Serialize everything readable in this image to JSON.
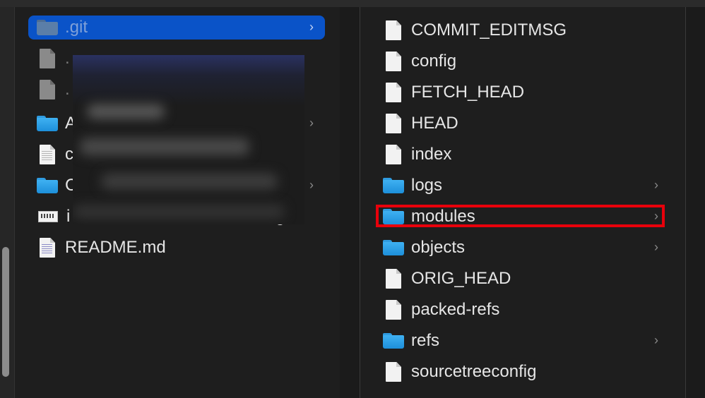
{
  "left_column": {
    "items": [
      {
        "label": ".git",
        "icon": "folder-icon",
        "has_children": true,
        "selected": true
      },
      {
        "label": ".",
        "icon": "file-icon",
        "has_children": false
      },
      {
        "label": ".",
        "icon": "file-icon",
        "has_children": false
      },
      {
        "label": "A",
        "icon": "folder-icon",
        "has_children": true
      },
      {
        "label": "c",
        "icon": "text-file-icon",
        "has_children": false
      },
      {
        "label": "C",
        "icon": "folder-icon",
        "has_children": true
      },
      {
        "label": "i",
        "icon": "image-file-icon",
        "has_children": false,
        "tail": "g"
      },
      {
        "label": "README.md",
        "icon": "markdown-file-icon",
        "has_children": false
      }
    ]
  },
  "right_column": {
    "items": [
      {
        "label": "COMMIT_EDITMSG",
        "icon": "file-icon",
        "has_children": false
      },
      {
        "label": "config",
        "icon": "file-icon",
        "has_children": false
      },
      {
        "label": "FETCH_HEAD",
        "icon": "file-icon",
        "has_children": false
      },
      {
        "label": "HEAD",
        "icon": "file-icon",
        "has_children": false
      },
      {
        "label": "index",
        "icon": "file-icon",
        "has_children": false
      },
      {
        "label": "logs",
        "icon": "folder-icon",
        "has_children": true
      },
      {
        "label": "modules",
        "icon": "folder-icon",
        "has_children": true,
        "highlighted": true
      },
      {
        "label": "objects",
        "icon": "folder-icon",
        "has_children": true
      },
      {
        "label": "ORIG_HEAD",
        "icon": "file-icon",
        "has_children": false
      },
      {
        "label": "packed-refs",
        "icon": "file-icon",
        "has_children": false
      },
      {
        "label": "refs",
        "icon": "folder-icon",
        "has_children": true
      },
      {
        "label": "sourcetreeconfig",
        "icon": "file-icon",
        "has_children": false
      }
    ]
  },
  "chevron": "›",
  "colors": {
    "background": "#1e1e1e",
    "selection": "#0a53c8",
    "folder": "#2f9be0",
    "highlight_border": "#e8000b"
  }
}
